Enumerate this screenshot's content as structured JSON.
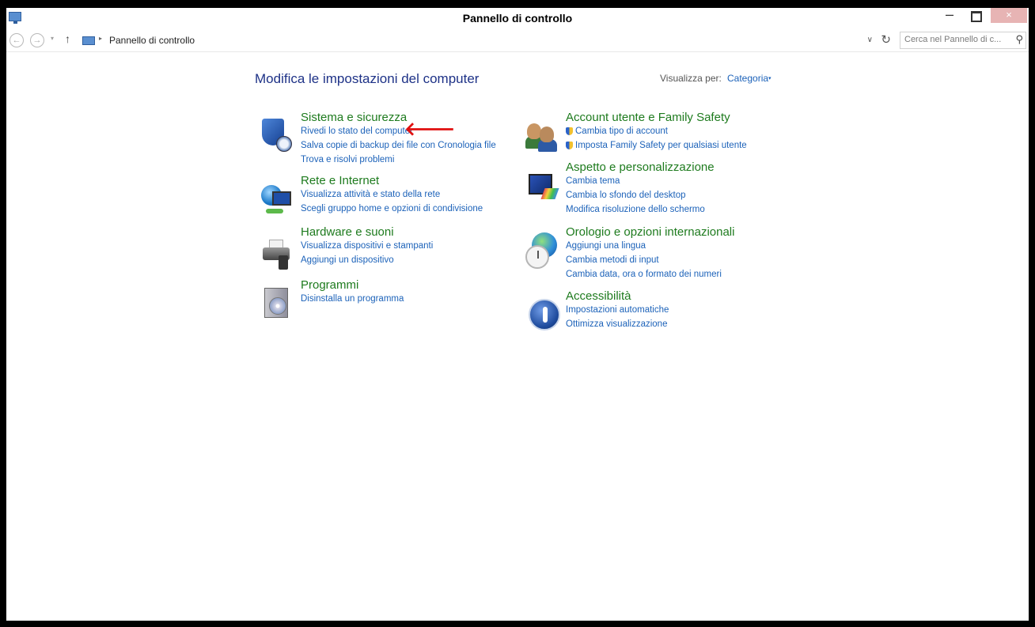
{
  "window": {
    "title": "Pannello di controllo",
    "minimize_glyph": "–",
    "close_glyph": "×"
  },
  "addressbar": {
    "back_glyph": "←",
    "forward_glyph": "→",
    "recent_glyph": "▾",
    "up_glyph": "↑",
    "separator_glyph": "▸",
    "breadcrumb": "Pannello di controllo",
    "dropdown_glyph": "∨",
    "refresh_glyph": "↻",
    "search_placeholder": "Cerca nel Pannello di c...",
    "search_glyph": "⚲"
  },
  "main": {
    "heading": "Modifica le impostazioni del computer",
    "view_by_label": "Visualizza per:",
    "view_by_value": "Categoria",
    "view_by_caret": "▾",
    "arrow_glyph": "🡐"
  },
  "categories": {
    "security": {
      "title": "Sistema e sicurezza",
      "links": [
        "Rivedi lo stato del computer",
        "Salva copie di backup dei file con Cronologia file",
        "Trova e risolvi problemi"
      ]
    },
    "network": {
      "title": "Rete e Internet",
      "links": [
        "Visualizza attività e stato della rete",
        "Scegli gruppo home e opzioni di condivisione"
      ]
    },
    "hardware": {
      "title": "Hardware e suoni",
      "links": [
        "Visualizza dispositivi e stampanti",
        "Aggiungi un dispositivo"
      ]
    },
    "programs": {
      "title": "Programmi",
      "links": [
        "Disinstalla un programma"
      ]
    },
    "accounts": {
      "title": "Account utente e Family Safety",
      "links": [
        "Cambia tipo di account",
        "Imposta Family Safety per qualsiasi utente"
      ]
    },
    "appearance": {
      "title": "Aspetto e personalizzazione",
      "links": [
        "Cambia tema",
        "Cambia lo sfondo del desktop",
        "Modifica risoluzione dello schermo"
      ]
    },
    "clock": {
      "title": "Orologio e opzioni internazionali",
      "links": [
        "Aggiungi una lingua",
        "Cambia metodi di input",
        "Cambia data, ora o formato dei numeri"
      ]
    },
    "accessibility": {
      "title": "Accessibilità",
      "links": [
        "Impostazioni automatiche",
        "Ottimizza visualizzazione"
      ]
    }
  }
}
